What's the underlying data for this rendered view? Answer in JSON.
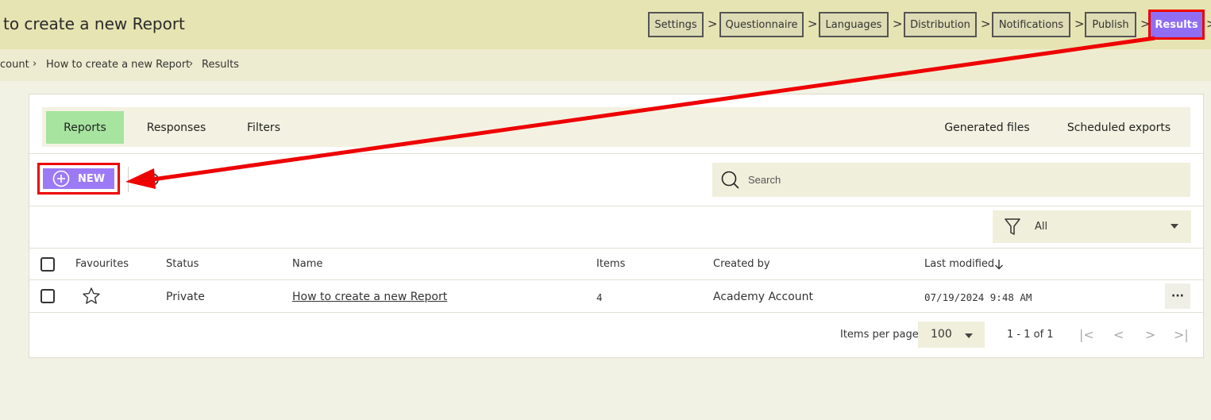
{
  "header": {
    "title": "to create a new Report",
    "steps": [
      "Settings",
      "Questionnaire",
      "Languages",
      "Distribution",
      "Notifications",
      "Publish",
      "Results"
    ],
    "active_step": "Results"
  },
  "breadcrumb": [
    "count",
    "How to create a new Report",
    "Results"
  ],
  "tabs": {
    "left": [
      "Reports",
      "Responses",
      "Filters"
    ],
    "right": [
      "Generated files",
      "Scheduled exports"
    ],
    "active": "Reports"
  },
  "toolbar": {
    "new_label": "NEW"
  },
  "search": {
    "placeholder": "Search"
  },
  "filter": {
    "value": "All"
  },
  "table": {
    "headers": [
      "Favourites",
      "Status",
      "Name",
      "Items",
      "Created by",
      "Last modified"
    ],
    "rows": [
      {
        "status": "Private",
        "name": "How to create a new Report",
        "items": "4",
        "created_by": "Academy Account",
        "last_modified": "07/19/2024 9:48 AM"
      }
    ]
  },
  "pagination": {
    "items_per_page_label": "Items per page",
    "per_page": "100",
    "range": "1 - 1 of 1"
  },
  "colors": {
    "accent_purple": "#9d7af5",
    "active_tab_green": "#a6e4a0",
    "annotation_red": "#e00000"
  },
  "icons": [
    "plus-circle-icon",
    "search-icon",
    "funnel-icon",
    "star-icon",
    "more-icon",
    "first-page-icon",
    "prev-page-icon",
    "next-page-icon",
    "last-page-icon"
  ]
}
